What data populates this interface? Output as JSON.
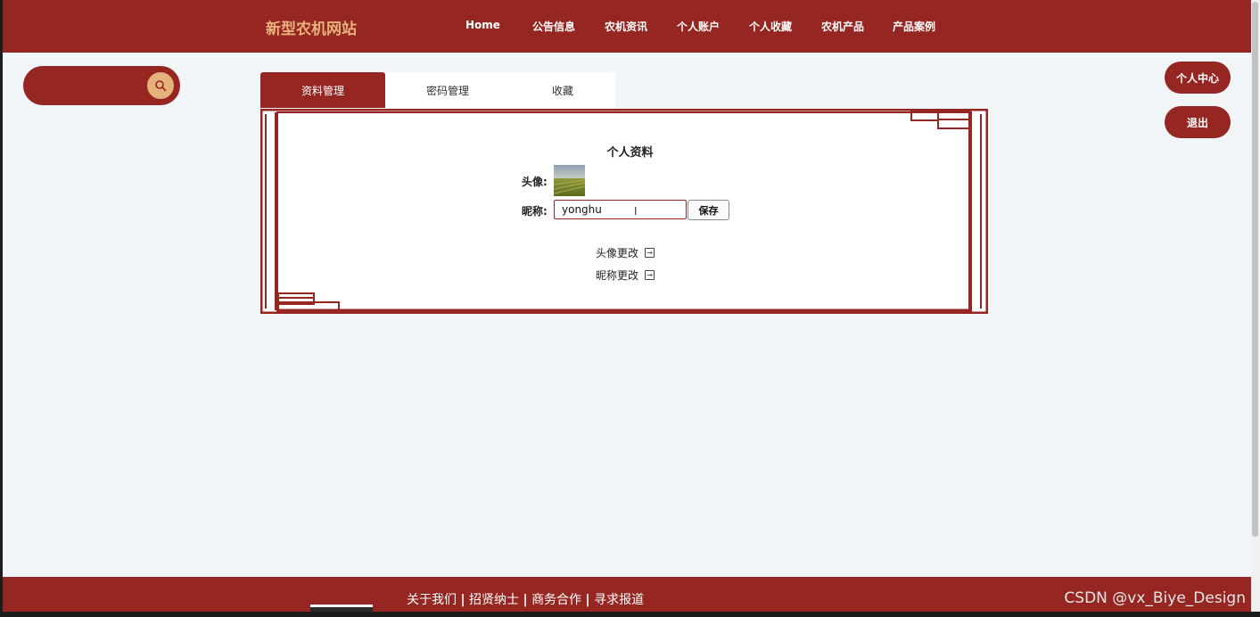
{
  "header": {
    "logo": "新型农机网站",
    "nav": [
      "Home",
      "公告信息",
      "农机资讯",
      "个人账户",
      "个人收藏",
      "农机产品",
      "产品案例"
    ]
  },
  "sidebar": {
    "search_icon": "search-icon",
    "personal_center": "个人中心",
    "logout": "退出"
  },
  "tabs": [
    "资料管理",
    "密码管理",
    "收藏"
  ],
  "active_tab": "资料管理",
  "profile": {
    "title": "个人资料",
    "avatar_label": "头像:",
    "nickname_label": "昵称:",
    "nickname_value": "yonghu",
    "save_label": "保存",
    "change_avatar": "头像更改",
    "change_nickname": "昵称更改"
  },
  "footer": {
    "links": [
      "关于我们",
      "招贤纳士",
      "商务合作",
      "寻求报道"
    ],
    "separator": "|",
    "watermark": "CSDN @vx_Biye_Design"
  },
  "colors": {
    "brand": "#962622",
    "logo_accent": "#e8b27a",
    "background": "#f2f5f8"
  }
}
